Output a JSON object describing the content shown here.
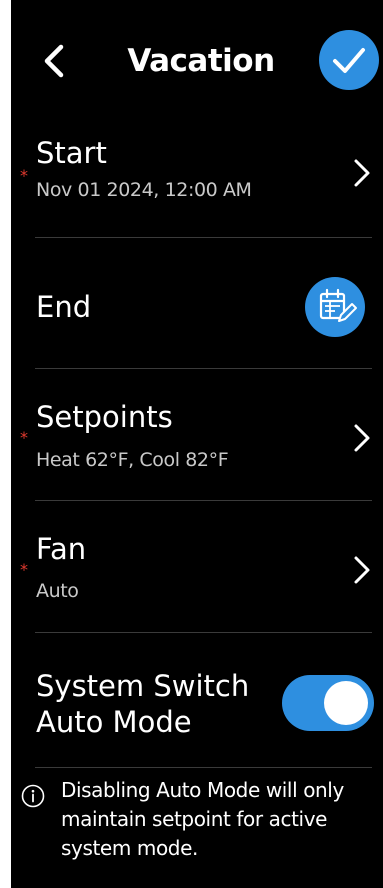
{
  "header": {
    "title": "Vacation",
    "back_icon": "chevron-left-icon",
    "confirm_icon": "checkmark-icon"
  },
  "start": {
    "label": "Start",
    "value": "Nov 01 2024, 12:00 AM",
    "required_mark": "*"
  },
  "end": {
    "label": "End",
    "action_icon": "calendar-edit-icon"
  },
  "setpoints": {
    "label": "Setpoints",
    "value": "Heat 62°F, Cool 82°F",
    "required_mark": "*"
  },
  "fan": {
    "label": "Fan",
    "value": "Auto",
    "required_mark": "*"
  },
  "system_switch": {
    "label": "System Switch Auto Mode",
    "enabled": true
  },
  "info": {
    "icon": "info-icon",
    "text": "Disabling Auto Mode will only maintain setpoint for active system mode."
  },
  "colors": {
    "background": "#000000",
    "accent": "#2e8fe0",
    "required": "#e03a2f",
    "secondary_text": "#c9c9c9"
  }
}
